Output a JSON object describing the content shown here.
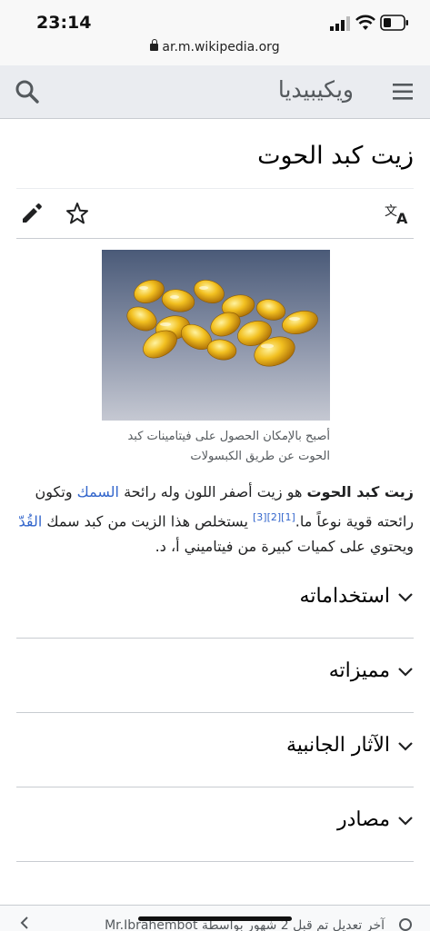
{
  "status": {
    "time": "23:14",
    "url": "ar.m.wikipedia.org"
  },
  "header": {
    "logo": "ويكيبيديا",
    "search_icon": "search-icon",
    "menu_icon": "hamburger-menu-icon"
  },
  "article": {
    "title": "زيت كبد الحوت",
    "actions": {
      "edit_icon": "pencil-icon",
      "watch_icon": "star-icon",
      "language_icon": "translate-icon"
    },
    "image_caption": "أصبح بالإمكان الحصول على فيتامينات كبد الحوت عن طريق الكبسولات",
    "intro": {
      "bold": "زيت كبد الحوت",
      "t1": " هو زيت أصفر اللون وله رائحة ",
      "link_fish": "السمك",
      "t2": " وتكون رائحته قوية نوعاً ما.",
      "refs": "[1][2][3]",
      "t3": " يستخلص هذا الزيت من كبد سمك ",
      "link_cod": "القُدّ",
      "t4": " ويحتوي على كميات كبيرة من فيتاميني أ، د."
    },
    "sections": [
      "استخداماته",
      "مميزاته",
      "الآثار الجانبية",
      "مصادر"
    ]
  },
  "footer": {
    "last_edit": "آخر تعديل تم قبل 2 شهور بواسطة Mr.Ibrahembot"
  },
  "colors": {
    "link": "#3366cc",
    "header_bg": "#eaecf0",
    "border": "#c8ccd1"
  }
}
